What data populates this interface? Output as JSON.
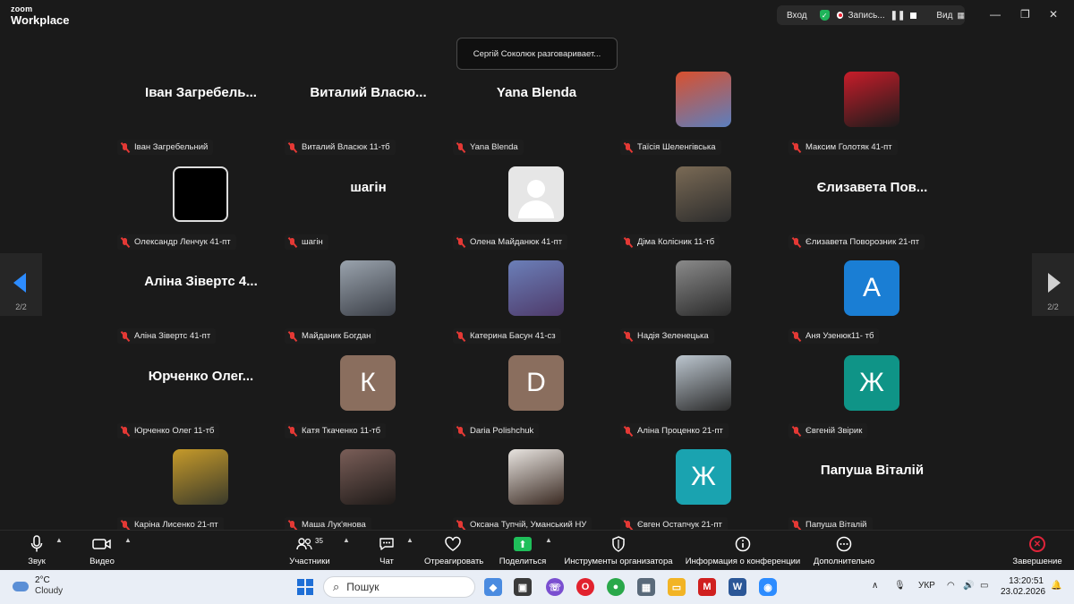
{
  "app": {
    "logo_line1": "zoom",
    "logo_line2": "Workplace"
  },
  "topbar": {
    "enter": "Вход",
    "recording": "Запись...",
    "view": "Вид"
  },
  "speaker_toast": "Сергій Соколюк разговаривает...",
  "pager": {
    "left": "2/2",
    "right": "2/2"
  },
  "participants": [
    {
      "display": "Іван Загребель...",
      "caption": "Іван Загребельний",
      "type": "name"
    },
    {
      "display": "Виталий Власю...",
      "caption": "Виталий Власюк 11-тб",
      "type": "name"
    },
    {
      "display": "Yana Blenda",
      "caption": "Yana Blenda",
      "type": "name"
    },
    {
      "display": "",
      "caption": "Таїсія Шеленгівська",
      "type": "photo",
      "bg": "#d9502e",
      "bg2": "#5b7fbf"
    },
    {
      "display": "",
      "caption": "Максим Голотяк 41-пт",
      "type": "photo",
      "bg": "#c81d2a",
      "bg2": "#1b1b1b"
    },
    {
      "display": "",
      "caption": "Олександр Ленчук 41-пт",
      "type": "photo",
      "bg": "#000000",
      "bg2": "#000000"
    },
    {
      "display": "шагін",
      "caption": "шагін",
      "type": "name"
    },
    {
      "display": "",
      "caption": "Олена Майданюк 41-пт",
      "type": "default"
    },
    {
      "display": "",
      "caption": "Діма Колісник 11-тб",
      "type": "photo",
      "bg": "#7a6a55",
      "bg2": "#2c2c2c"
    },
    {
      "display": "Єлизавета Пов...",
      "caption": "Єлизавета Поворозник 21-пт",
      "type": "name"
    },
    {
      "display": "Аліна Зівертс 4...",
      "caption": "Аліна Зівертс 41-пт",
      "type": "name"
    },
    {
      "display": "",
      "caption": "Майданик Богдан",
      "type": "photo",
      "bg": "#9aa3ad",
      "bg2": "#3b3f47"
    },
    {
      "display": "",
      "caption": "Катерина Басун 41-сз",
      "type": "photo",
      "bg": "#6b7fb8",
      "bg2": "#4e3a6a"
    },
    {
      "display": "",
      "caption": "Надія Зеленецька",
      "type": "photo",
      "bg": "#8a8a8a",
      "bg2": "#2a2a2a"
    },
    {
      "display": "А",
      "caption": "Аня Узенюк11- тб",
      "type": "letter",
      "color": "#1a7ed4"
    },
    {
      "display": "Юрченко Олег...",
      "caption": "Юрченко Олег 11-тб",
      "type": "name"
    },
    {
      "display": "К",
      "caption": "Катя Ткаченко 11-тб",
      "type": "letter",
      "color": "#8a6e5e"
    },
    {
      "display": "D",
      "caption": "Daria Polishchuk",
      "type": "letter",
      "color": "#8a6e5e"
    },
    {
      "display": "",
      "caption": "Аліна Проценко 21-пт",
      "type": "photo",
      "bg": "#bcc6cf",
      "bg2": "#2a2a2a"
    },
    {
      "display": "Ж",
      "caption": "Євгеній Звірик",
      "type": "letter",
      "color": "#0f9487"
    },
    {
      "display": "",
      "caption": "Каріна Лисенко 21-пт",
      "type": "photo",
      "bg": "#c69a2a",
      "bg2": "#3a3a2a"
    },
    {
      "display": "",
      "caption": "Маша Лук'янова",
      "type": "photo",
      "bg": "#7a5e58",
      "bg2": "#1e1a18"
    },
    {
      "display": "",
      "caption": "Оксана Тупчій, Уманський НУ",
      "type": "photo",
      "bg": "#e8e4e0",
      "bg2": "#3a2a22"
    },
    {
      "display": "Ж",
      "caption": "Євген Остапчук 21-пт",
      "type": "letter",
      "color": "#1aa3b0"
    },
    {
      "display": "Папуша Віталій",
      "caption": "Папуша Віталій",
      "type": "name"
    }
  ],
  "toolbar": {
    "audio": "Звук",
    "video": "Видео",
    "participants": "Участники",
    "participants_count": "35",
    "chat": "Чат",
    "react": "Отреагировать",
    "share": "Поделиться",
    "host_tools": "Инструменты организатора",
    "meeting_info": "Информация о конференции",
    "more": "Дополнительно",
    "end": "Завершение"
  },
  "taskbar": {
    "temp": "2°C",
    "condition": "Cloudy",
    "search_placeholder": "Пошук",
    "language": "УКР",
    "time": "13:20:51",
    "date": "23.02.2026"
  }
}
